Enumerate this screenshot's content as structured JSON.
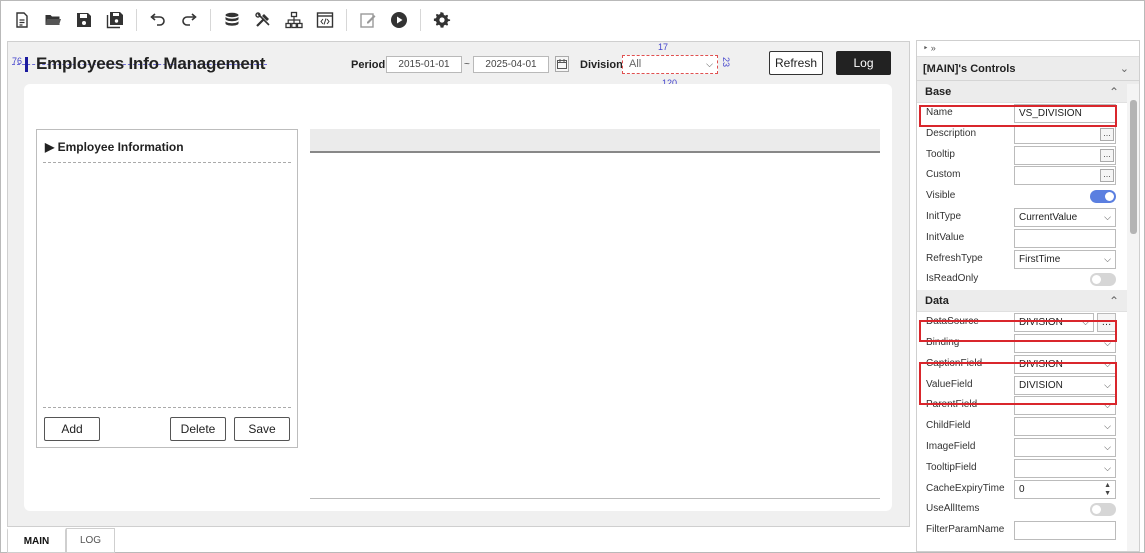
{
  "toolbar": {
    "icons": [
      "new-file-icon",
      "open-folder-icon",
      "save-icon",
      "save-all-icon",
      "undo-icon",
      "redo-icon",
      "database-icon",
      "tools-icon",
      "tree-icon",
      "code-icon",
      "edit-icon",
      "play-icon",
      "settings-icon"
    ]
  },
  "designer": {
    "title": "Employees Info Management",
    "period_label": "Period",
    "date_from": "2015-01-01",
    "tilde": "~",
    "date_to": "2025-04-01",
    "division_label": "Division",
    "division_value": "All",
    "dim_top": "17",
    "dim_right": "23",
    "dim_bottom": "120",
    "dim_left": "76",
    "refresh_label": "Refresh",
    "log_label": "Log",
    "employee_panel_title": "Employee Information",
    "add_label": "Add",
    "delete_label": "Delete",
    "save_label": "Save"
  },
  "tabs": [
    {
      "label": "MAIN"
    },
    {
      "label": "LOG"
    }
  ],
  "props": {
    "top_bar": "‣ »",
    "title": "[MAIN]'s Controls",
    "sections": {
      "base": "Base",
      "data": "Data"
    },
    "base_rows": [
      {
        "name": "Name",
        "value": "VS_DIVISION"
      },
      {
        "name": "Description",
        "value": ""
      },
      {
        "name": "Tooltip",
        "value": ""
      },
      {
        "name": "Custom",
        "value": ""
      },
      {
        "name": "Visible",
        "value": ""
      },
      {
        "name": "InitType",
        "value": "CurrentValue"
      },
      {
        "name": "InitValue",
        "value": ""
      },
      {
        "name": "RefreshType",
        "value": "FirstTime"
      },
      {
        "name": "IsReadOnly",
        "value": ""
      }
    ],
    "data_rows": [
      {
        "name": "DataSource",
        "value": "DIVISION"
      },
      {
        "name": "Binding",
        "value": ""
      },
      {
        "name": "CaptionField",
        "value": "DIVISION"
      },
      {
        "name": "ValueField",
        "value": "DIVISION"
      },
      {
        "name": "ParentField",
        "value": ""
      },
      {
        "name": "ChildField",
        "value": ""
      },
      {
        "name": "ImageField",
        "value": ""
      },
      {
        "name": "TooltipField",
        "value": ""
      },
      {
        "name": "CacheExpiryTime",
        "value": "0"
      },
      {
        "name": "UseAllItems",
        "value": ""
      },
      {
        "name": "FilterParamName",
        "value": ""
      }
    ],
    "colors": {
      "highlight": "#d9262c",
      "toggle_on": "#5b7fe0",
      "toggle_off": "#d6d6d6"
    }
  }
}
